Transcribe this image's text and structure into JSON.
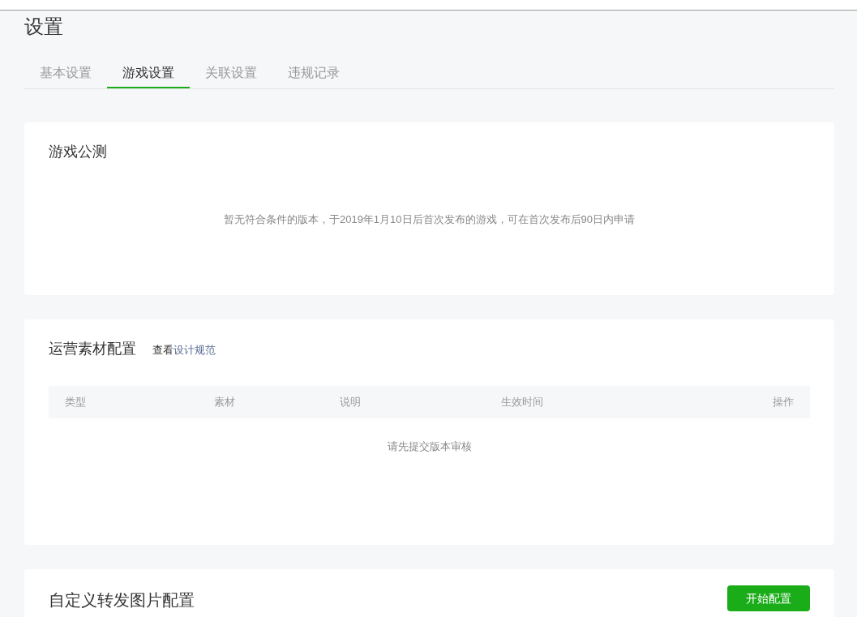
{
  "page_title": "设置",
  "tabs": [
    {
      "label": "基本设置",
      "selected": false
    },
    {
      "label": "游戏设置",
      "selected": true
    },
    {
      "label": "关联设置",
      "selected": false
    },
    {
      "label": "违规记录",
      "selected": false
    }
  ],
  "public_test": {
    "title": "游戏公测",
    "message": "暂无符合条件的版本，于2019年1月10日后首次发布的游戏，可在首次发布后90日内申请"
  },
  "materials": {
    "title": "运营素材配置",
    "hint_prefix": "查看",
    "hint_link": "设计规范",
    "columns": [
      "类型",
      "素材",
      "说明",
      "生效时间",
      "操作"
    ],
    "empty_text": "请先提交版本审核"
  },
  "share_image": {
    "title": "自定义转发图片配置",
    "button": "开始配置"
  }
}
